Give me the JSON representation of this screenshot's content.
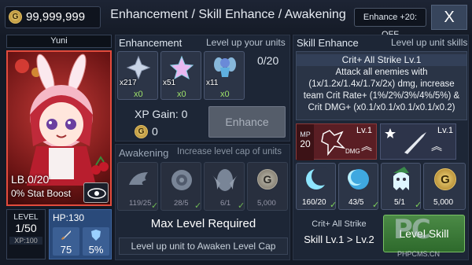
{
  "top": {
    "gold": "99,999,999",
    "gold_icon": "G",
    "title": "Enhancement / Skill Enhance / Awakening",
    "toggle": "Enhance +20: OFF",
    "close": "X"
  },
  "unit": {
    "name": "Yuni",
    "lb": "LB.0/20",
    "stat_boost": "0% Stat Boost",
    "level_label": "LEVEL",
    "level": "1/50",
    "xp": "XP:100",
    "hp": "HP:130",
    "atk": "75",
    "def": "5%"
  },
  "enhancement": {
    "title": "Enhancement",
    "subtitle": "Level up your units",
    "count": "0/20",
    "materials": [
      {
        "owned": "x217",
        "used": "x0",
        "icon": "silver-star-icon"
      },
      {
        "owned": "x51",
        "used": "x0",
        "icon": "rainbow-star-icon"
      },
      {
        "owned": "x11",
        "used": "x0",
        "icon": "fairy-icon"
      }
    ],
    "xp_gain": "XP Gain: 0",
    "cost": "0",
    "button": "Enhance"
  },
  "awakening": {
    "title": "Awakening",
    "subtitle": "Increase level cap of units",
    "items": [
      {
        "count": "119/25",
        "icon": "wing-icon"
      },
      {
        "count": "28/5",
        "icon": "disc-icon"
      },
      {
        "count": "6/1",
        "icon": "wings-emblem-icon"
      },
      {
        "count": "5,000",
        "icon": "gold-coin-icon"
      }
    ],
    "status": "Max Level Required",
    "hint": "Level up unit to Awaken Level Cap"
  },
  "skill": {
    "title": "Skill Enhance",
    "subtitle": "Level up unit skills",
    "name": "Crit+ All Strike Lv.1",
    "desc": "Attack all enemies with (1x/1.2x/1.4x/1.7x/2x) dmg, increase team Crit Rate+ (1%/2%/3%/4%/5%) & Crit DMG+ (x0.1/x0.1/x0.1/x0.1/x0.2)",
    "mp_label": "MP",
    "mp": "20",
    "skill1_lv": "Lv.1",
    "skill2_lv": "Lv.1",
    "dmg": "DMG",
    "materials": [
      {
        "count": "160/20",
        "icon": "crescent-icon"
      },
      {
        "count": "43/5",
        "icon": "moon-orb-icon"
      },
      {
        "count": "5/1",
        "icon": "ghost-icon"
      },
      {
        "count": "5,000",
        "icon": "gold-coin-icon"
      }
    ],
    "upgrade_name": "Crit+ All Strike",
    "upgrade": "Skill Lv.1 > Lv.2",
    "button": "Level Skill"
  },
  "watermark": "PHPCMS.CN",
  "colors": {
    "accent_green": "#9fe36a",
    "portrait_border": "#e24b3c",
    "gold": "#e3c063"
  }
}
